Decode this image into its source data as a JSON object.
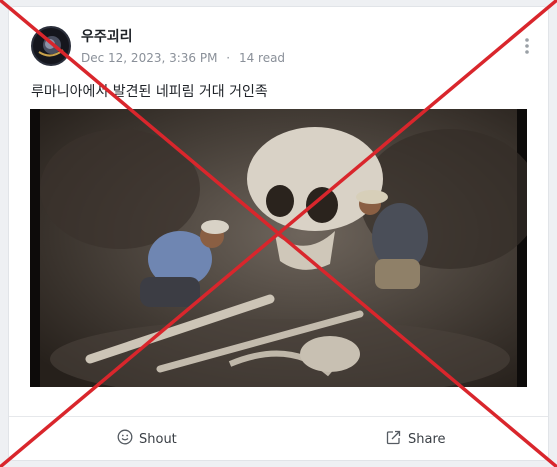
{
  "post": {
    "author": "우주괴리",
    "date": "Dec 12, 2023, 3:36 PM",
    "separator": "·",
    "reads": "14 read",
    "caption": "루마니아에서 발견된 네피림 거대 거인족"
  },
  "actions": {
    "shout_label": "Shout",
    "share_label": "Share"
  },
  "overlay": {
    "cross_color": "#d9262c"
  }
}
